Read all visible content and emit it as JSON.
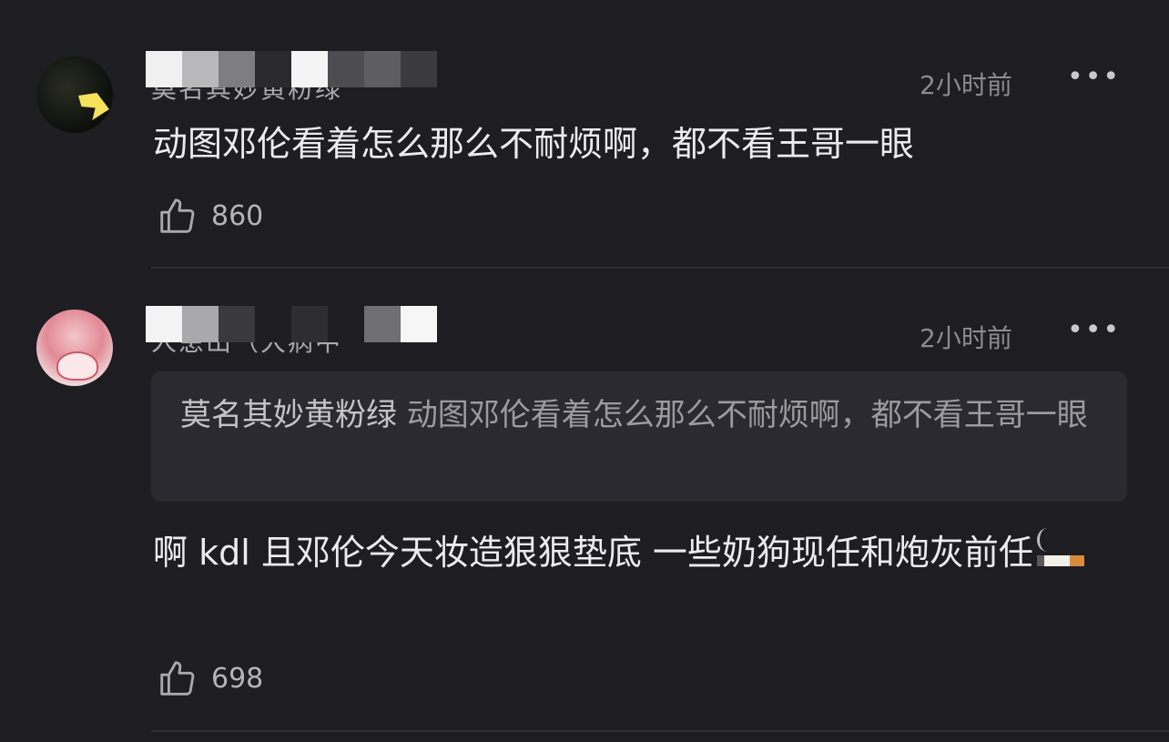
{
  "comments": [
    {
      "username_partial": "莫名其妙黄粉绿",
      "timestamp": "2小时前",
      "more_label": "•••",
      "text": "动图邓伦看着怎么那么不耐烦啊，都不看王哥一眼",
      "likes": "860"
    },
    {
      "username_partial": "人患山（大病中",
      "timestamp": "2小时前",
      "more_label": "•••",
      "quote": {
        "author": "莫名其妙黄粉绿",
        "text": "动图邓伦看着怎么那么不耐烦啊，都不看王哥一眼"
      },
      "text": "啊 kdl 且邓伦今天妆造狠狠垫底 一些奶狗现任和炮灰前任",
      "emoji": "cigarette-emoji",
      "likes": "698"
    }
  ],
  "colors": {
    "background": "#1e1d22",
    "text_primary": "#ececee",
    "text_secondary": "#8c8b91",
    "quote_background": "#2b2a30"
  }
}
